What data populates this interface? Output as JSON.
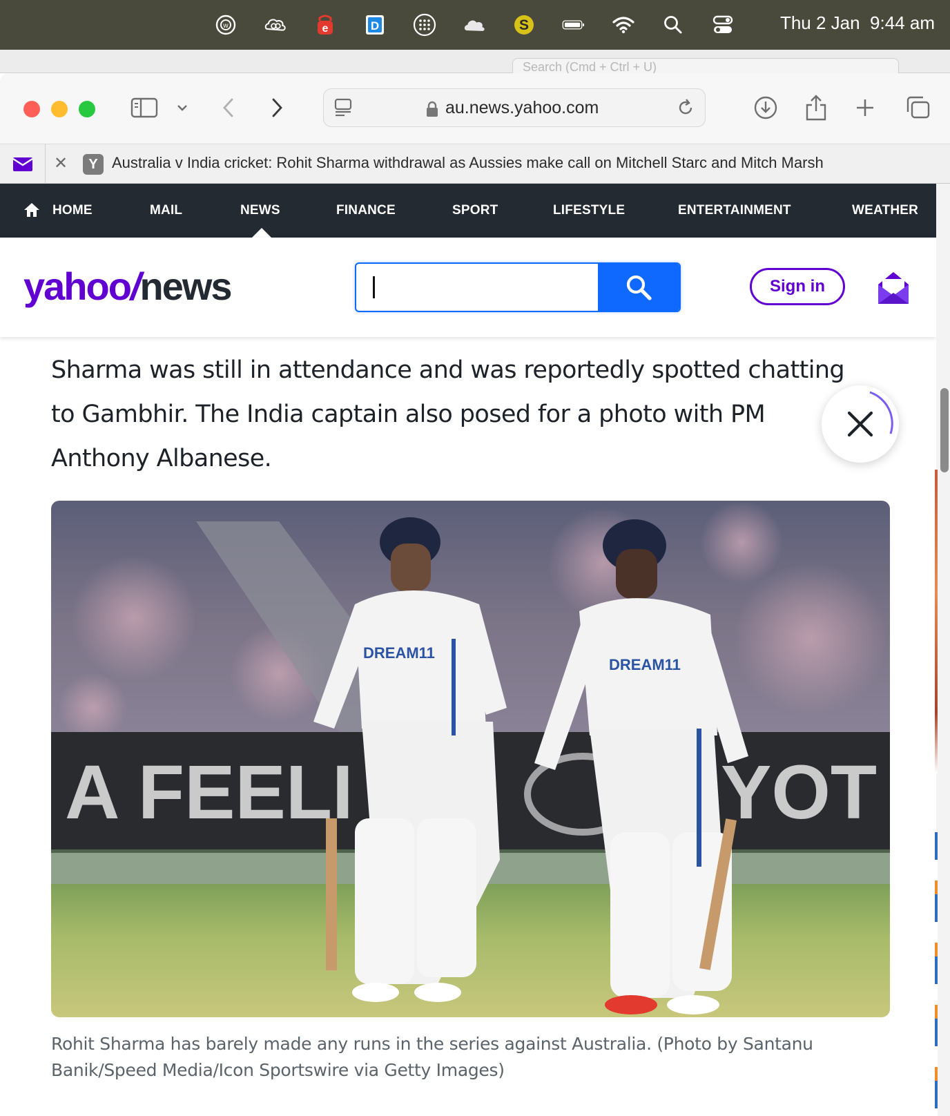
{
  "menubar": {
    "clock_date": "Thu 2 Jan",
    "clock_time": "9:44 am",
    "icons": [
      "w-circle-icon",
      "creative-cloud-icon",
      "e-red-icon",
      "d-blue-app-icon",
      "dots-grid-icon",
      "cloud-icon",
      "s-yellow-app-icon",
      "battery-icon",
      "wifi-icon",
      "spotlight-search-icon",
      "control-center-icon"
    ]
  },
  "background_window": {
    "search_placeholder": "Search (Cmd + Ctrl + U)"
  },
  "browser": {
    "url": "au.news.yahoo.com",
    "tab_title": "Australia v India cricket: Rohit Sharma withdrawal as Aussies make call on Mitchell Starc and Mitch Marsh",
    "tab_favicon_letter": "Y"
  },
  "yahoo_nav": {
    "items": [
      "HOME",
      "MAIL",
      "NEWS",
      "FINANCE",
      "SPORT",
      "LIFESTYLE",
      "ENTERTAINMENT",
      "WEATHER"
    ],
    "active": "NEWS"
  },
  "header": {
    "logo_yahoo": "yahoo",
    "logo_slash": "/",
    "logo_news": "news",
    "search_value": "",
    "signin_label": "Sign in",
    "brand_color": "#6001d2",
    "search_color": "#0f69ff"
  },
  "article": {
    "paragraph": "Sharma was still in attendance and was reportedly spotted chatting to Gambhir. The India captain also posed for a photo with PM Anthony Albanese.",
    "photo_banner_left": "A FEELI",
    "photo_banner_right": "YOT",
    "jersey_text": "DREAM11",
    "caption": "Rohit Sharma has barely made any runs in the series against Australia. (Photo by Santanu Banik/Speed Media/Icon Sportswire via Getty Images)"
  }
}
